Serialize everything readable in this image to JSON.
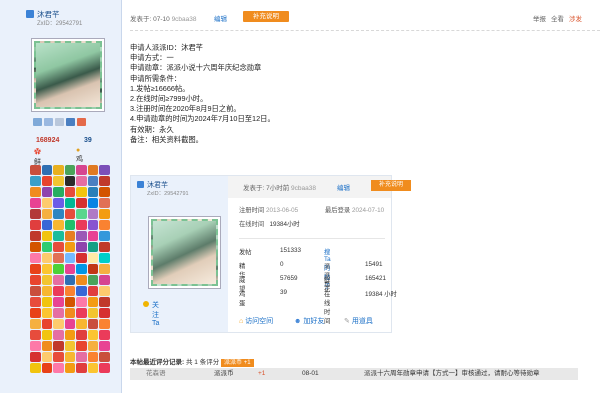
{
  "author": {
    "name": "沐君芊",
    "zxid": "ZxID：29542791",
    "stat1_value": "168924",
    "stat2_value": "39",
    "stat1_label": "鲜花",
    "stat2_label": "鸡蛋"
  },
  "post_header": {
    "posted": "发表于: 07-10",
    "posted_by": "9cbaa38",
    "edit": "编辑",
    "supplement_button": "补充说明",
    "report": "举报",
    "view_all": "全看",
    "tease": "涉发"
  },
  "post_body": [
    "申请人派派ID：沐君芊",
    "申请方式：一",
    "申请勋章：派派小说十六周年庆纪念勋章",
    "申请所需条件：",
    "1.发帖≥16666帖。",
    "2.在线时间≥7999小时。",
    "3.注册时间在2020年8月9日之前。",
    "4.申请勋章的时间为2024年7月10日至12日。",
    "有效期：永久",
    "备注：相关资料截图。"
  ],
  "quote": {
    "name": "沐君芊",
    "zxid": "ZxID：29542791",
    "posted": "发表于: 7小时前",
    "posted_by": "9cbaa38",
    "edit": "编辑",
    "supplement_button": "补充说明",
    "reg_label": "注册时间",
    "reg_value": "2013-06-05",
    "last_label": "最后登录",
    "last_value": "2024-07-10",
    "online_label": "在线时间",
    "online_value": "19384小时",
    "posts_label": "发帖",
    "posts_value": "151333",
    "search_link": "搜Ta的帖子",
    "essence_label": "精华",
    "essence_value": "0",
    "coin_label": "派派币",
    "coin_value": "15491",
    "prestige_label": "威望",
    "prestige_value": "57659",
    "flower_label": "鲜花",
    "flower_value": "165421",
    "egg_label": "鸡蛋",
    "egg_value": "39",
    "online2_label": "在线时间",
    "online2_value": "19384 小时",
    "follow": "关注Ta",
    "visit": "访问空间",
    "add_friend": "加好友",
    "use_item": "用道具"
  },
  "rating": {
    "title": "本帖最近评分记录:",
    "count": "共 1 条评分",
    "badge": "派派币 +1",
    "row": {
      "user": "花森语",
      "type": "派派币",
      "value": "+1",
      "date": "08-01",
      "reason": "派派十六周年勋章申请【方式一】审核通过，请耐心等待勋章"
    }
  }
}
